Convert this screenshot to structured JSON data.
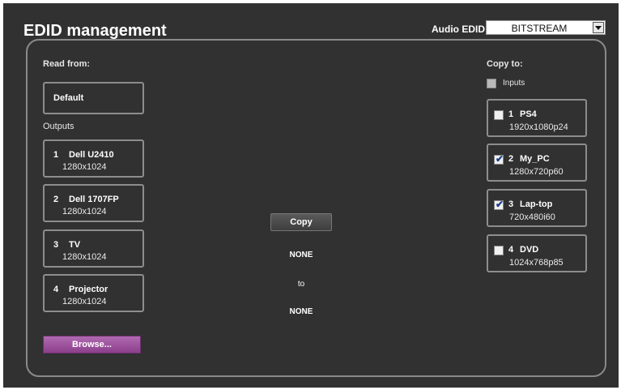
{
  "header": {
    "title": "EDID management",
    "audio_label": "Audio EDID",
    "audio_value": "BITSTREAM"
  },
  "read_from": {
    "label": "Read from:",
    "default_label": "Default",
    "outputs_label": "Outputs",
    "outputs": [
      {
        "num": "1",
        "name": "Dell U2410",
        "res": "1280x1024"
      },
      {
        "num": "2",
        "name": "Dell 1707FP",
        "res": "1280x1024"
      },
      {
        "num": "3",
        "name": "TV",
        "res": "1280x1024"
      },
      {
        "num": "4",
        "name": "Projector",
        "res": "1280x1024"
      }
    ],
    "browse_label": "Browse..."
  },
  "middle": {
    "copy_label": "Copy",
    "source": "NONE",
    "to_label": "to",
    "target": "NONE"
  },
  "copy_to": {
    "label": "Copy to:",
    "inputs_label": "Inputs",
    "inputs": [
      {
        "num": "1",
        "name": "PS4",
        "res": "1920x1080p24",
        "checked": false
      },
      {
        "num": "2",
        "name": "My_PC",
        "res": "1280x720p60",
        "checked": true
      },
      {
        "num": "3",
        "name": "Lap-top",
        "res": "720x480i60",
        "checked": true
      },
      {
        "num": "4",
        "name": "DVD",
        "res": "1024x768p85",
        "checked": false
      }
    ]
  }
}
